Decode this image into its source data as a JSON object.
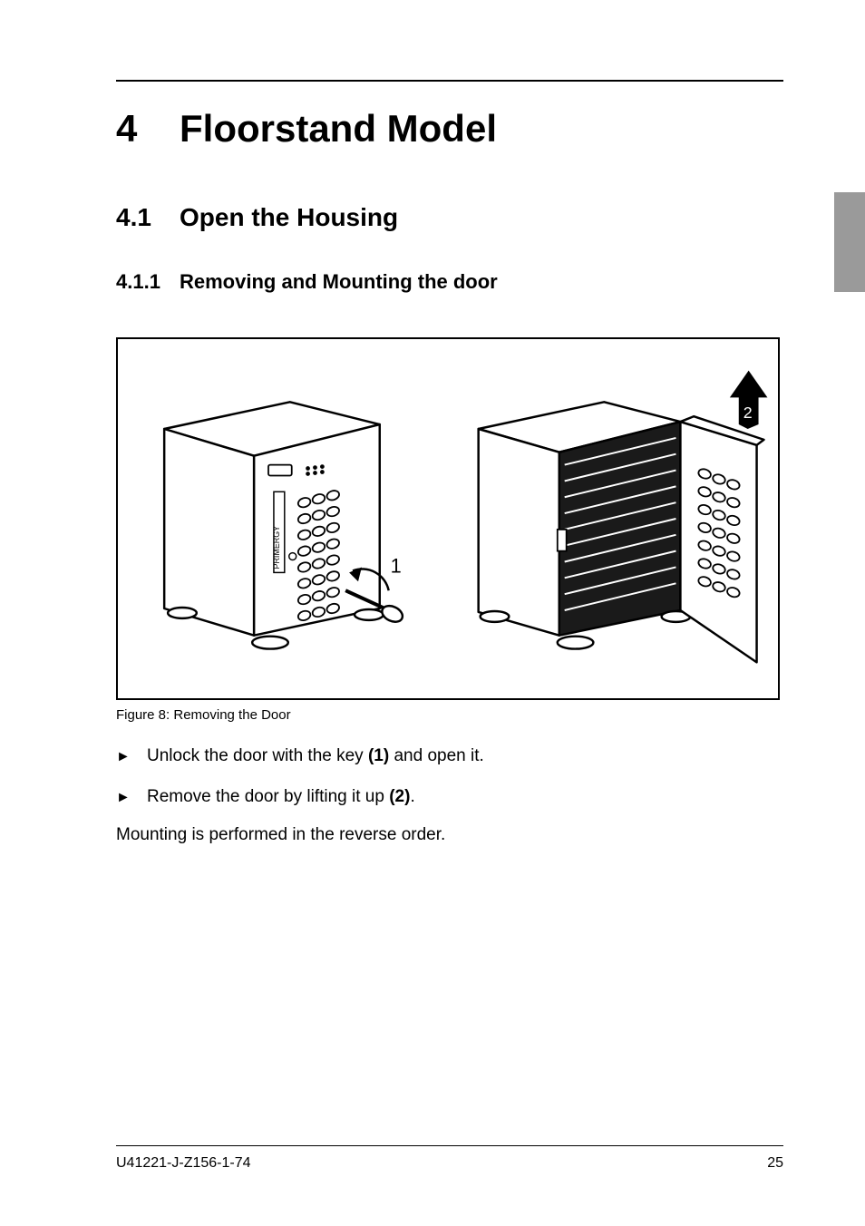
{
  "chapter": {
    "number": "4",
    "title": "Floorstand Model"
  },
  "section1": {
    "number": "4.1",
    "title": "Open the Housing"
  },
  "section2": {
    "number": "4.1.1",
    "title": "Removing and Mounting the door"
  },
  "figure": {
    "caption": "Figure 8: Removing the Door",
    "callout1": "1",
    "callout2": "2",
    "device_label": "PRIMERGY"
  },
  "steps": [
    {
      "pre": "Unlock the door with the key ",
      "bold": "(1)",
      "post": " and open it."
    },
    {
      "pre": "Remove the door by lifting it up ",
      "bold": "(2)",
      "post": "."
    }
  ],
  "body_after_steps": "Mounting is performed in the reverse order.",
  "footer": {
    "doc_id": "U41221-J-Z156-1-74",
    "page_number": "25"
  },
  "glyphs": {
    "step_marker": "►"
  }
}
